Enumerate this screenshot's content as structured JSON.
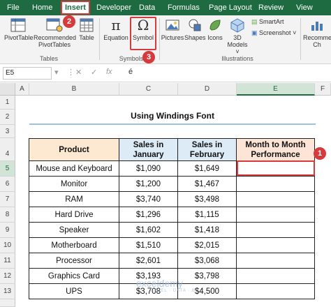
{
  "ribbon_tabs": [
    "File",
    "Home",
    "Insert",
    "Developer",
    "Data",
    "Formulas",
    "Page Layout",
    "Review",
    "View"
  ],
  "callouts": [
    "1",
    "2",
    "3"
  ],
  "ribbon": {
    "pivottable": "PivotTable",
    "recommended_pivot_1": "Recommended",
    "recommended_pivot_2": "PivotTables",
    "table": "Table",
    "tables_group": "Tables",
    "equation": "Equation",
    "symbol": "Symbol",
    "symbols_group": "Symbols",
    "pictures": "Pictures",
    "shapes": "Shapes",
    "icons": "Icons",
    "models_1": "3D",
    "models_2": "Models",
    "smartart": "SmartArt",
    "screenshot": "Screenshot",
    "illustrations_group": "Illustrations",
    "recommended_charts_1": "Recommen",
    "recommended_charts_2": "Ch"
  },
  "formula_bar": {
    "cell_ref": "E5",
    "cancel": "✕",
    "enter": "✓",
    "fx": "fx",
    "value": "é"
  },
  "columns": [
    "A",
    "B",
    "C",
    "D",
    "E",
    "F"
  ],
  "rows": [
    "1",
    "2",
    "3",
    "4",
    "5",
    "6",
    "7",
    "8",
    "9",
    "10",
    "11",
    "12",
    "13"
  ],
  "sheet": {
    "title": "Using Windings Font",
    "headers": [
      "Product",
      "Sales in January",
      "Sales in February",
      "Month to Month Performance"
    ],
    "data": [
      [
        "Mouse and Keyboard",
        "$1,090",
        "$1,649",
        ""
      ],
      [
        "Monitor",
        "$1,200",
        "$1,467",
        ""
      ],
      [
        "RAM",
        "$3,740",
        "$3,498",
        ""
      ],
      [
        "Hard Drive",
        "$1,296",
        "$1,115",
        ""
      ],
      [
        "Speaker",
        "$1,602",
        "$1,418",
        ""
      ],
      [
        "Motherboard",
        "$1,510",
        "$2,015",
        ""
      ],
      [
        "Processor",
        "$2,601",
        "$3,068",
        ""
      ],
      [
        "Graphics Card",
        "$3,193",
        "$3,798",
        ""
      ],
      [
        "UPS",
        "$3,708",
        "$4,500",
        ""
      ]
    ]
  },
  "watermark": {
    "name": "exceldemy",
    "tagline": "EXCEL · DATA · BI"
  },
  "colors": {
    "ribbon_green": "#1e6b42",
    "header_product": "#fde9d1",
    "header_sales": "#ddebf7",
    "header_performance": "#fce4d6",
    "callout_red": "#d63a3a"
  }
}
